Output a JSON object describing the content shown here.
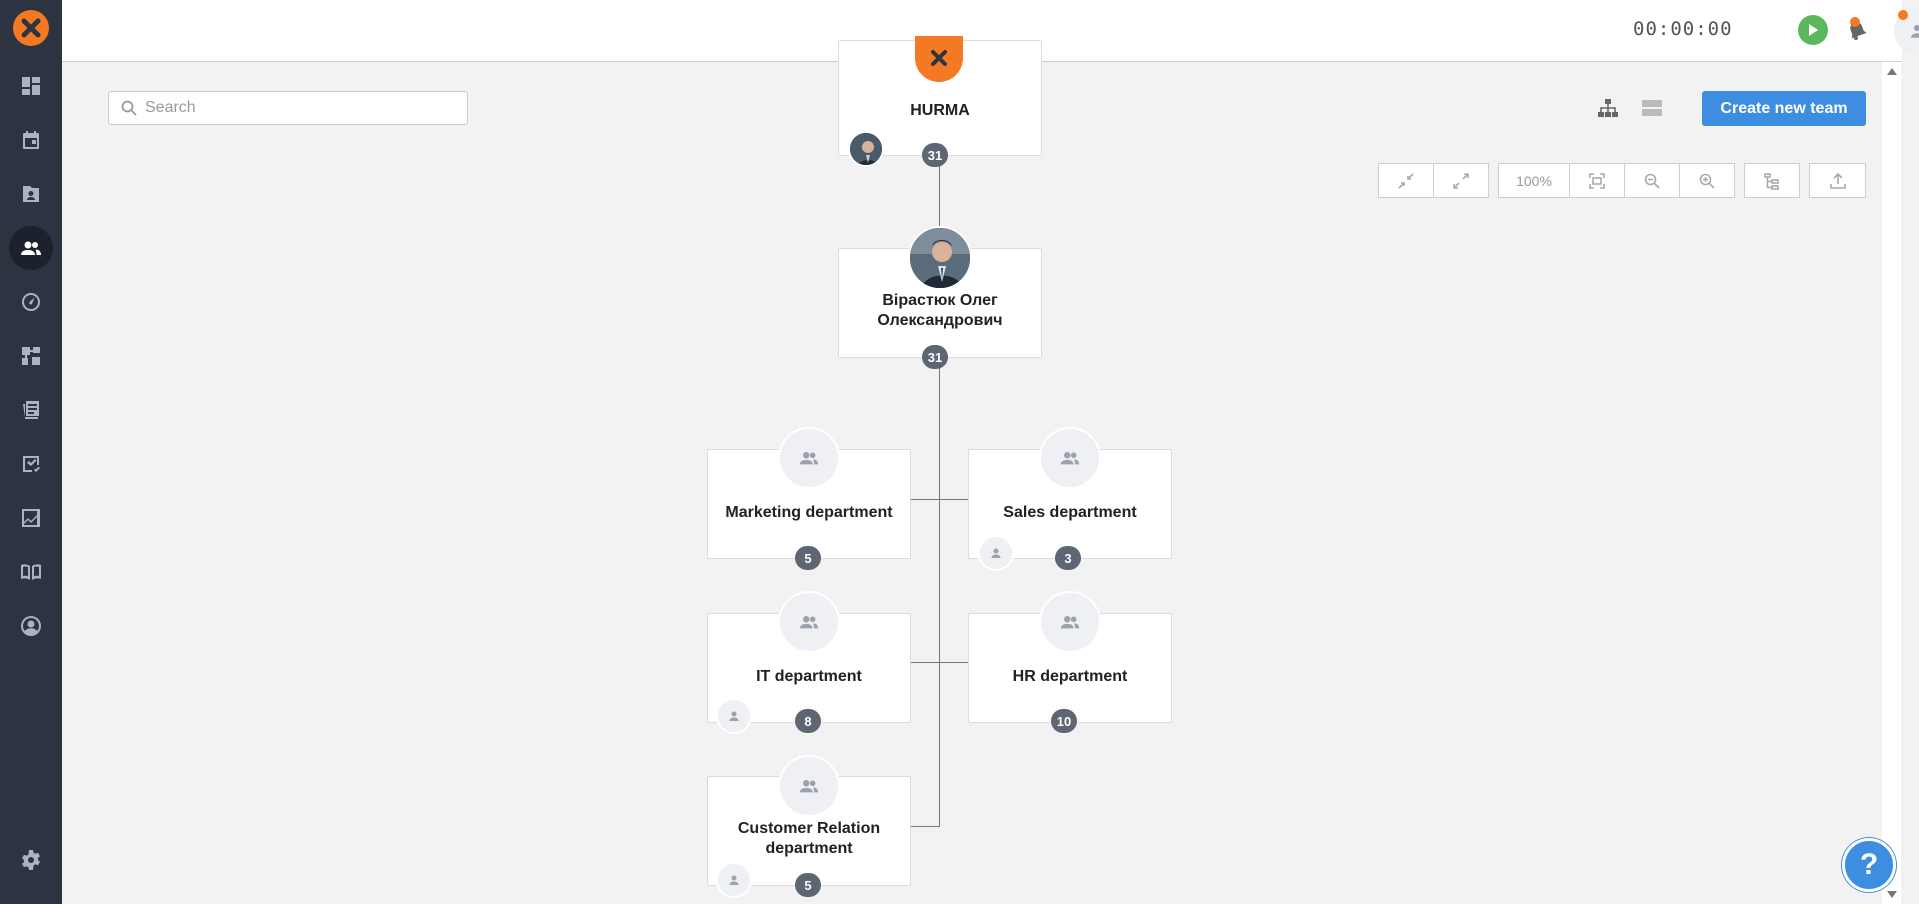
{
  "header": {
    "timer": "00:00:00"
  },
  "search": {
    "placeholder": "Search"
  },
  "toolbar": {
    "create_label": "Create new team",
    "zoom_level": "100%"
  },
  "sidebar": {
    "items": [
      {
        "icon": "dashboard-icon"
      },
      {
        "icon": "calendar-icon"
      },
      {
        "icon": "candidates-icon"
      },
      {
        "icon": "team-icon",
        "active": true
      },
      {
        "icon": "speedometer-icon"
      },
      {
        "icon": "workflow-icon"
      },
      {
        "icon": "library-icon"
      },
      {
        "icon": "tasks-icon"
      },
      {
        "icon": "analytics-icon"
      },
      {
        "icon": "knowledge-base-icon"
      },
      {
        "icon": "profile-icon"
      },
      {
        "icon": "settings-icon"
      }
    ]
  },
  "org": {
    "root": {
      "name": "HURMA",
      "count": "31"
    },
    "head": {
      "name_line1": "Вірастюк Олег",
      "name_line2": "Олександрович",
      "count": "31"
    },
    "departments": [
      {
        "name": "Marketing department",
        "count": "5"
      },
      {
        "name": "Sales department",
        "count": "3"
      },
      {
        "name": "IT department",
        "count": "8"
      },
      {
        "name": "HR department",
        "count": "10"
      },
      {
        "name_line1": "Customer Relation",
        "name_line2": "department",
        "count": "5"
      }
    ]
  },
  "help": {
    "label": "?"
  },
  "colors": {
    "sidebar": "#2c3441",
    "brand": "#f47922",
    "primary": "#3d8ee0",
    "play": "#5cb85c",
    "badge": "#5e6573"
  }
}
